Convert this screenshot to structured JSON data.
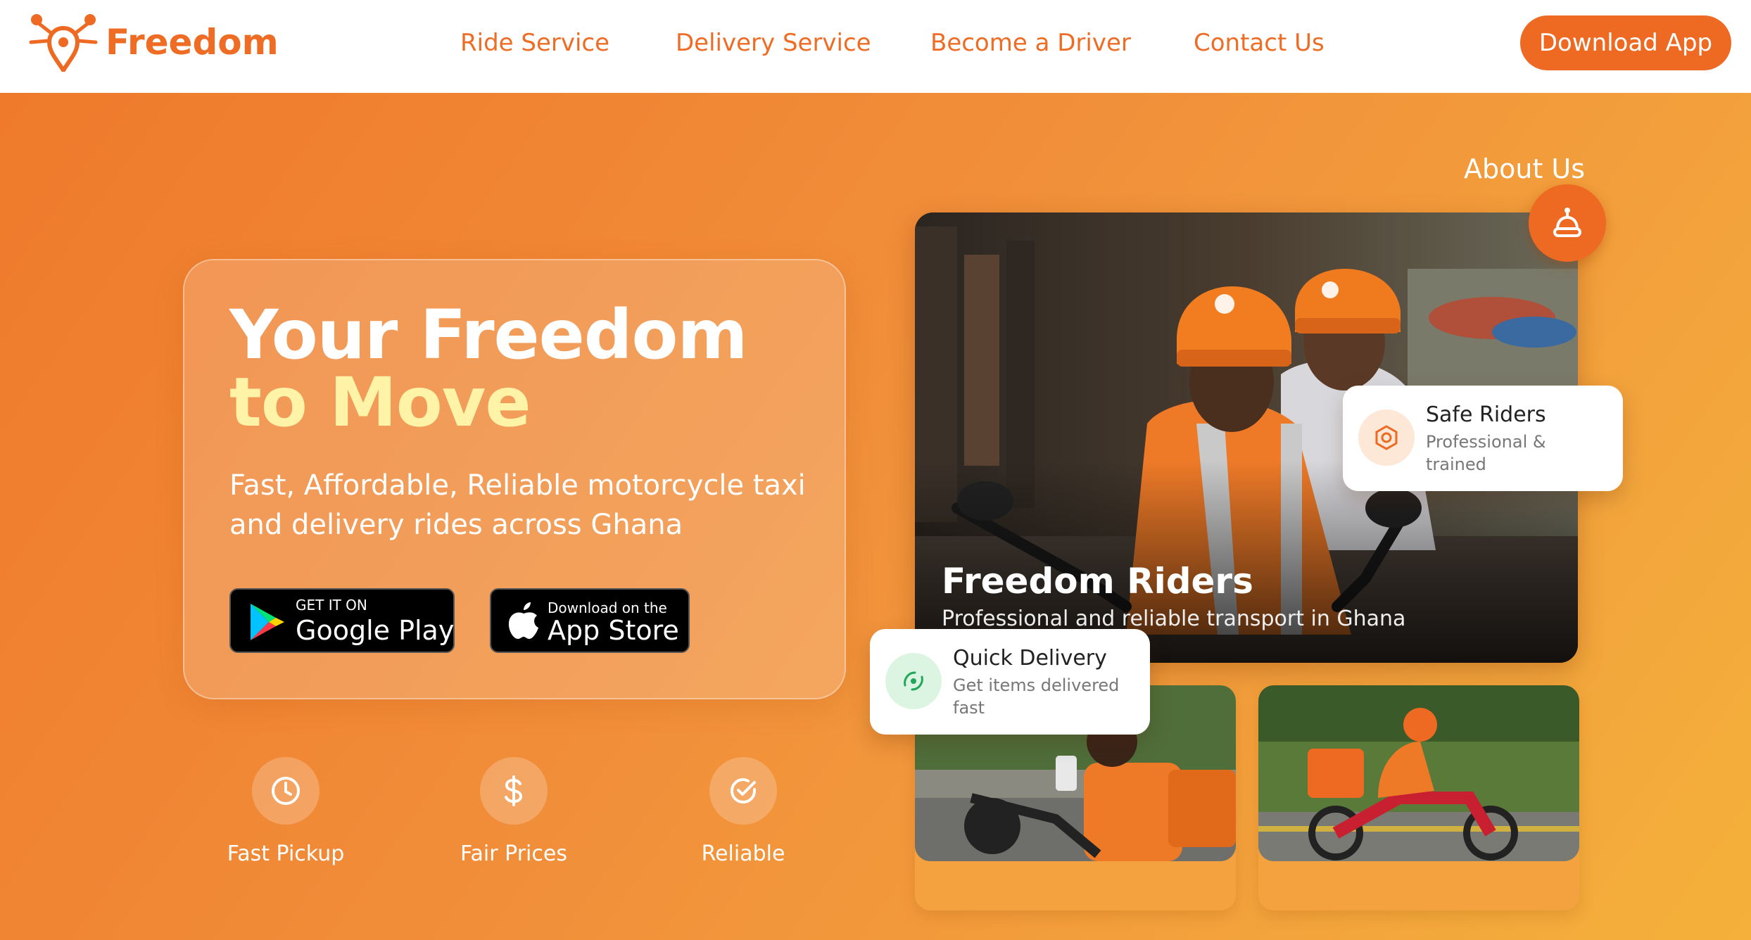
{
  "header": {
    "brand": "Freedom",
    "nav": [
      "Ride Service",
      "Delivery Service",
      "Become a Driver",
      "Contact Us"
    ],
    "cta": "Download App"
  },
  "hero": {
    "headline_line1": "Your Freedom",
    "headline_line2": "to Move",
    "subtitle": "Fast, Affordable, Reliable motorcycle taxi and delivery rides across Ghana",
    "google_play": {
      "small": "GET IT ON",
      "big": "Google Play"
    },
    "app_store": {
      "small": "Download on the",
      "big": "App Store"
    },
    "features": [
      {
        "label": "Fast Pickup",
        "icon": "clock-icon"
      },
      {
        "label": "Fair Prices",
        "icon": "dollar-icon"
      },
      {
        "label": "Reliable",
        "icon": "check-circle-icon"
      }
    ]
  },
  "about": {
    "label": "About Us",
    "photo_title": "Freedom Riders",
    "photo_subtitle": "Professional and reliable transport in Ghana",
    "safe_card": {
      "title": "Safe Riders",
      "subtitle": "Professional & trained"
    },
    "quick_card": {
      "title": "Quick Delivery",
      "subtitle": "Get items delivered fast"
    }
  },
  "colors": {
    "brand_orange": "#ee6a22",
    "headline_accent": "#fff3a8",
    "quick_icon_bg": "#dcf5e2",
    "safe_icon_bg": "#fde7d6"
  }
}
